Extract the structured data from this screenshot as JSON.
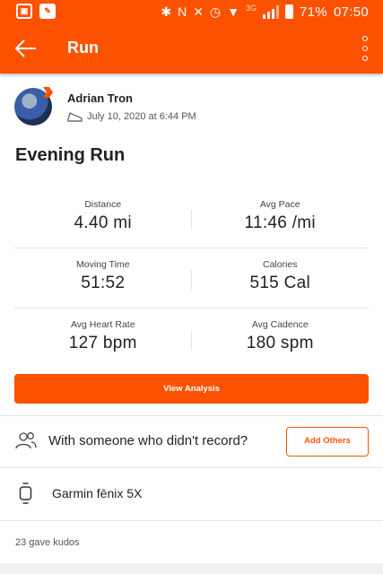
{
  "status_bar": {
    "network": "3G",
    "battery": "71%",
    "time": "07:50"
  },
  "app_bar": {
    "title": "Run"
  },
  "header": {
    "athlete_name": "Adrian Tron",
    "date": "July 10, 2020 at 6:44 PM"
  },
  "activity": {
    "title": "Evening Run"
  },
  "stats": [
    {
      "label": "Distance",
      "value": "4.40 mi"
    },
    {
      "label": "Avg Pace",
      "value": "11:46 /mi"
    },
    {
      "label": "Moving Time",
      "value": "51:52"
    },
    {
      "label": "Calories",
      "value": "515 Cal"
    },
    {
      "label": "Avg Heart Rate",
      "value": "127 bpm"
    },
    {
      "label": "Avg Cadence",
      "value": "180 spm"
    }
  ],
  "actions": {
    "view_analysis": "View Analysis",
    "others_prompt": "With someone who didn't record?",
    "add_others": "Add Others"
  },
  "device": {
    "name": "Garmin fēnix 5X"
  },
  "kudos": {
    "text": "23 gave kudos"
  },
  "colors": {
    "accent": "#fc5200"
  },
  "icons": [
    "back-arrow-icon",
    "overflow-menu-icon",
    "shoe-icon",
    "people-icon",
    "watch-icon"
  ]
}
